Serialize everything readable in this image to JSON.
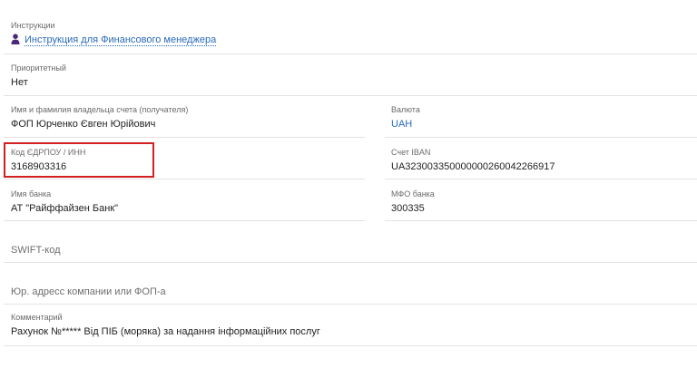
{
  "instructions": {
    "label": "Инструкции",
    "link_text": "Инструкция для Финансового менеджера",
    "icon": "user-icon"
  },
  "priority": {
    "label": "Приоритетный",
    "value": "Нет"
  },
  "owner": {
    "label": "Имя и фамилия владельца счета (получателя)",
    "value": "ФОП Юрченко Євген Юрійович"
  },
  "currency": {
    "label": "Валюта",
    "value": "UAH",
    "color": "#2a6ab8"
  },
  "edrpou": {
    "label": "Код ЄДРПОУ / ИНН",
    "value": "3168903316",
    "highlight_color": "#d21f1f"
  },
  "iban": {
    "label": "Счет IBAN",
    "value": "UA323003350000000260042266917"
  },
  "bank_name": {
    "label": "Имя банка",
    "value": "АТ \"Райффайзен Банк\""
  },
  "mfo": {
    "label": "МФО банка",
    "value": "300335"
  },
  "swift": {
    "placeholder": "SWIFT-код"
  },
  "legal_address": {
    "placeholder": "Юр. адресс компании или ФОП-а"
  },
  "comment": {
    "label": "Комментарий",
    "value": "Рахунок №***** Від ПІБ (моряка) за надання інформаційних послуг"
  }
}
